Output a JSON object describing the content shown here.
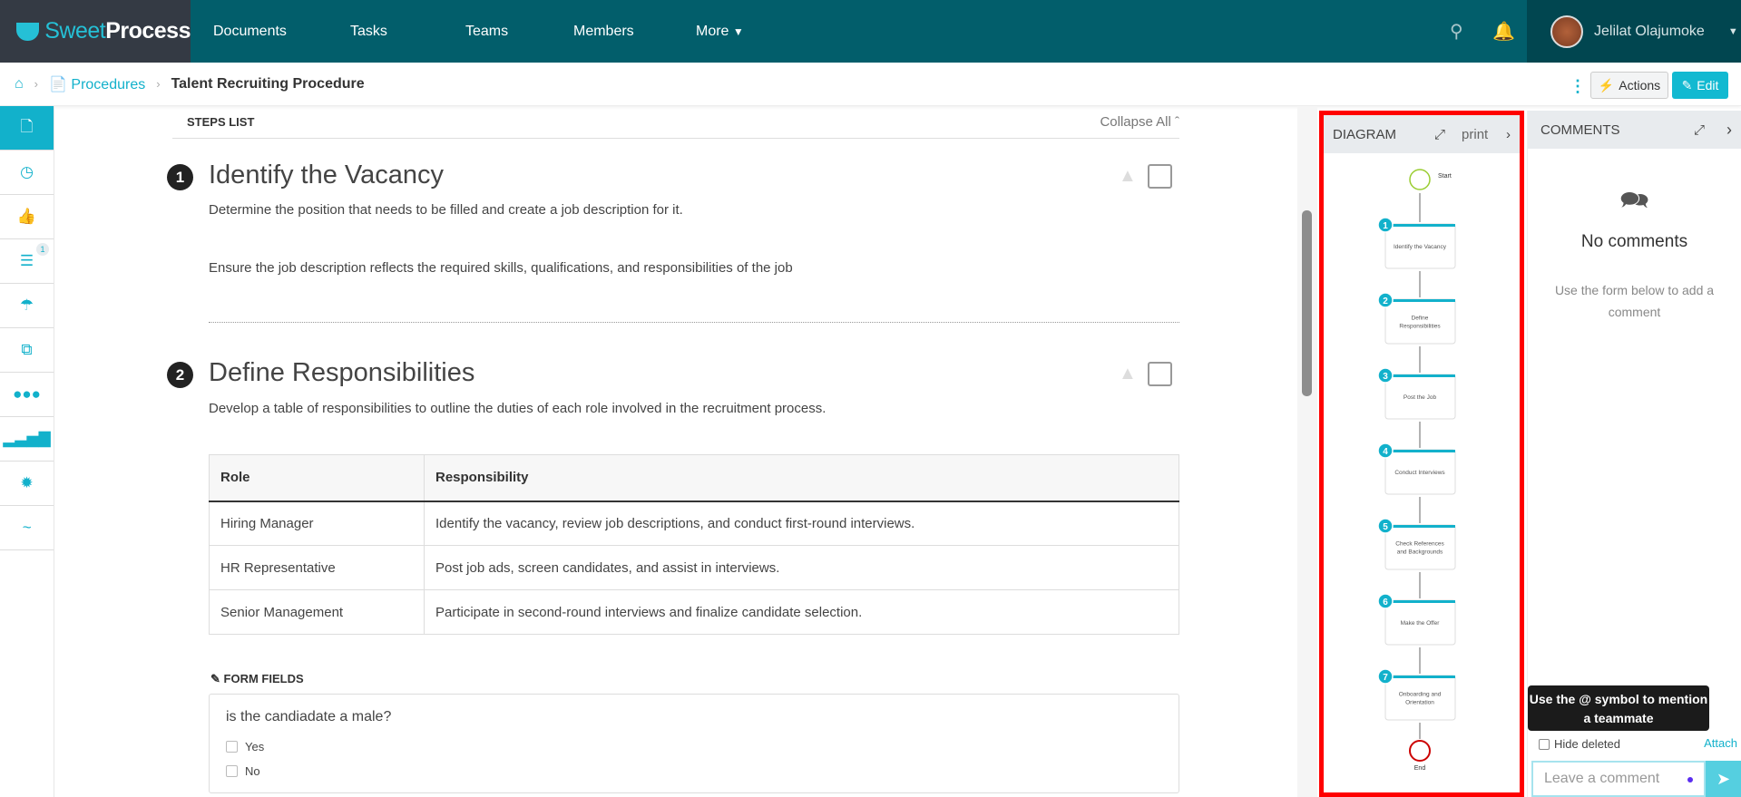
{
  "brand": {
    "name_light": "Sweet",
    "name_bold": "Process"
  },
  "nav": {
    "items": [
      "Documents",
      "Tasks",
      "Teams",
      "Members",
      "More"
    ],
    "user": "Jelilat Olajumoke"
  },
  "breadcrumb": {
    "section": "Procedures",
    "current": "Talent Recruiting Procedure"
  },
  "toolbar": {
    "actions": "Actions",
    "edit": "Edit"
  },
  "sidebar": {
    "items": [
      "document-icon",
      "clock-icon",
      "thumbs-up-icon",
      "checklist-icon",
      "umbrella-icon",
      "copy-icon",
      "users-icon",
      "signal-icon",
      "badge-icon",
      "signature-icon"
    ],
    "checklist_badge": "1",
    "accent": "#12b1cb"
  },
  "steps": {
    "header": "STEPS LIST",
    "collapse": "Collapse All",
    "items": [
      {
        "num": "1",
        "title": "Identify the Vacancy",
        "p1": "Determine the position that needs to be filled and create a job description for it.",
        "p2": "Ensure the job description reflects the required skills, qualifications, and responsibilities of the job"
      },
      {
        "num": "2",
        "title": "Define Responsibilities",
        "p1": "Develop a table of responsibilities to outline the duties of each role involved in the recruitment process."
      }
    ],
    "table": {
      "headers": [
        "Role",
        "Responsibility"
      ],
      "rows": [
        [
          "Hiring Manager",
          "Identify the vacancy, review job descriptions, and conduct first-round interviews."
        ],
        [
          "HR Representative",
          "Post job ads, screen candidates, and assist in interviews."
        ],
        [
          "Senior Management",
          "Participate in second-round interviews and finalize candidate selection."
        ]
      ]
    },
    "form": {
      "label": "FORM FIELDS",
      "question": "is the candiadate a male?",
      "options": [
        "Yes",
        "No"
      ]
    }
  },
  "diagram": {
    "title": "DIAGRAM",
    "print": "print",
    "start": "Start",
    "end": "End",
    "steps": [
      [
        "1",
        "Identify the Vacancy"
      ],
      [
        "2",
        "Define",
        "Responsibilities"
      ],
      [
        "3",
        "Post the Job"
      ],
      [
        "4",
        "Conduct Interviews"
      ],
      [
        "5",
        "Check References",
        "and Backgrounds"
      ],
      [
        "6",
        "Make the Offer"
      ],
      [
        "7",
        "Onboarding and",
        "Orientation"
      ]
    ]
  },
  "comments": {
    "title": "COMMENTS",
    "empty": "No comments",
    "hint": "Use the form below to add a comment",
    "tooltip": "Use the @ symbol to mention a teammate",
    "hide_deleted": "Hide deleted",
    "attach": "Attach",
    "placeholder": "Leave a comment"
  }
}
